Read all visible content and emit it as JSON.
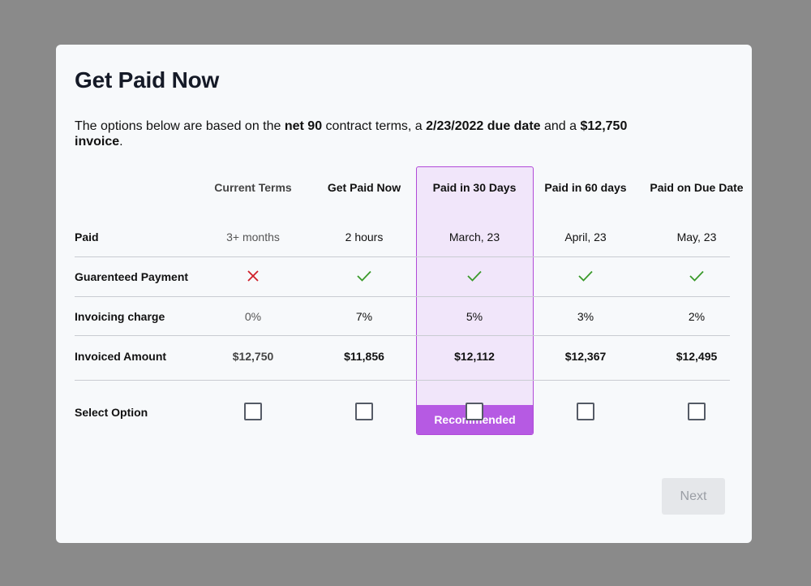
{
  "modal": {
    "title": "Get Paid Now",
    "description": {
      "pre": "The options below are based on the ",
      "term": "net 90",
      "mid1": " contract terms, a ",
      "due": "2/23/2022 due date",
      "mid2": " and a ",
      "amount": "$12,750 invoice",
      "post": "."
    }
  },
  "columns": [
    {
      "label": "Current Terms"
    },
    {
      "label": "Get Paid Now"
    },
    {
      "label": "Paid in 30 Days"
    },
    {
      "label": "Paid in 60 days"
    },
    {
      "label": "Paid on Due Date"
    }
  ],
  "rows": {
    "paid": {
      "label": "Paid",
      "values": [
        "3+ months",
        "2 hours",
        "March, 23",
        "April, 23",
        "May, 23"
      ]
    },
    "guaranteed": {
      "label": "Guarenteed Payment",
      "icons": [
        "x-icon",
        "check-icon",
        "check-icon",
        "check-icon",
        "check-icon"
      ]
    },
    "charge": {
      "label": "Invoicing charge",
      "values": [
        "0%",
        "7%",
        "5%",
        "3%",
        "2%"
      ]
    },
    "amount": {
      "label": "Invoiced Amount",
      "values": [
        "$12,750",
        "$11,856",
        "$12,112",
        "$12,367",
        "$12,495"
      ]
    },
    "select": {
      "label": "Select Option"
    }
  },
  "recommended_label": "Recommended",
  "next_label": "Next",
  "colors": {
    "accent": "#b65ae3",
    "highlight_bg": "#f1e6fa",
    "check": "#3a9a2a",
    "cross": "#d0202a"
  }
}
